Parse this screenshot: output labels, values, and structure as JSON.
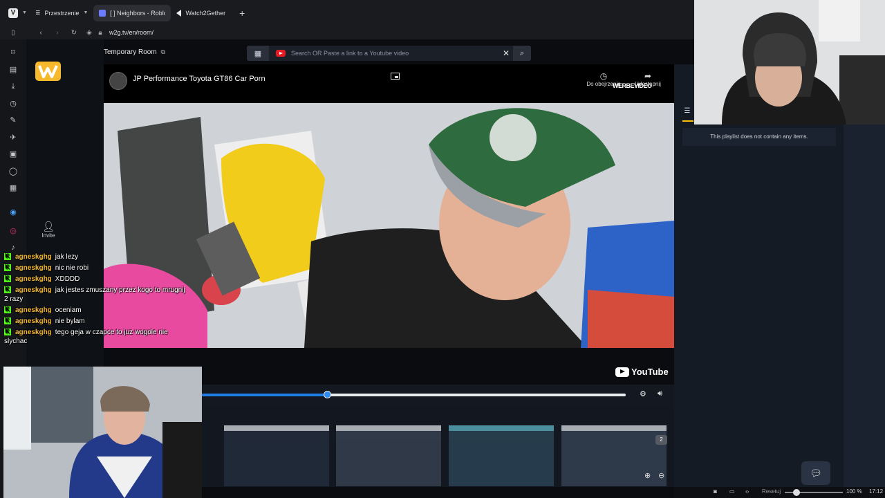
{
  "browser": {
    "workspace_label": "Przestrzenie",
    "tabs": [
      {
        "label": "[ ] Neighbors - Roblo"
      },
      {
        "label": "Watch2Gether"
      }
    ],
    "url": "w2g.tv/en/room/"
  },
  "room": {
    "title": "Temporary Room",
    "search_placeholder": "Search OR Paste a link to a Youtube video",
    "invite_label": "Invite"
  },
  "video": {
    "title": "JP Performance Toyota GT86 Car Porn",
    "watch_later_label": "Do obejrzenia",
    "share_label": "Udostępnij",
    "watermark": "WERBEVIDEO",
    "logo_text": "YouTube",
    "progress": 0.295
  },
  "thumbnails": {
    "badge_count": "2",
    "count": 4
  },
  "playlist": {
    "empty_text": "This playlist does not contain any items."
  },
  "chat": {
    "messages": [
      {
        "user": "agneskghg",
        "text": "jak lezy"
      },
      {
        "user": "agneskghg",
        "text": "nic nie robi"
      },
      {
        "user": "agneskghg",
        "text": "XDDDD"
      },
      {
        "user": "agneskghg",
        "text": "jak jestes zmuszany przez kogo to mrugnij 2 razy"
      },
      {
        "user": "agneskghg",
        "text": "oceniam"
      },
      {
        "user": "agneskghg",
        "text": "nie bylam"
      },
      {
        "user": "agneskghg",
        "text": "tego geja w czapce to juz wogole nie slychac"
      }
    ]
  },
  "taskbar": {
    "reset_label": "Resetuj",
    "zoom": "100 %",
    "time": "17:12"
  },
  "colors": {
    "accent": "#ffc107",
    "youtube_red": "#e51c23",
    "kick_green": "#53fc18",
    "progress_blue": "#1f7de6"
  }
}
